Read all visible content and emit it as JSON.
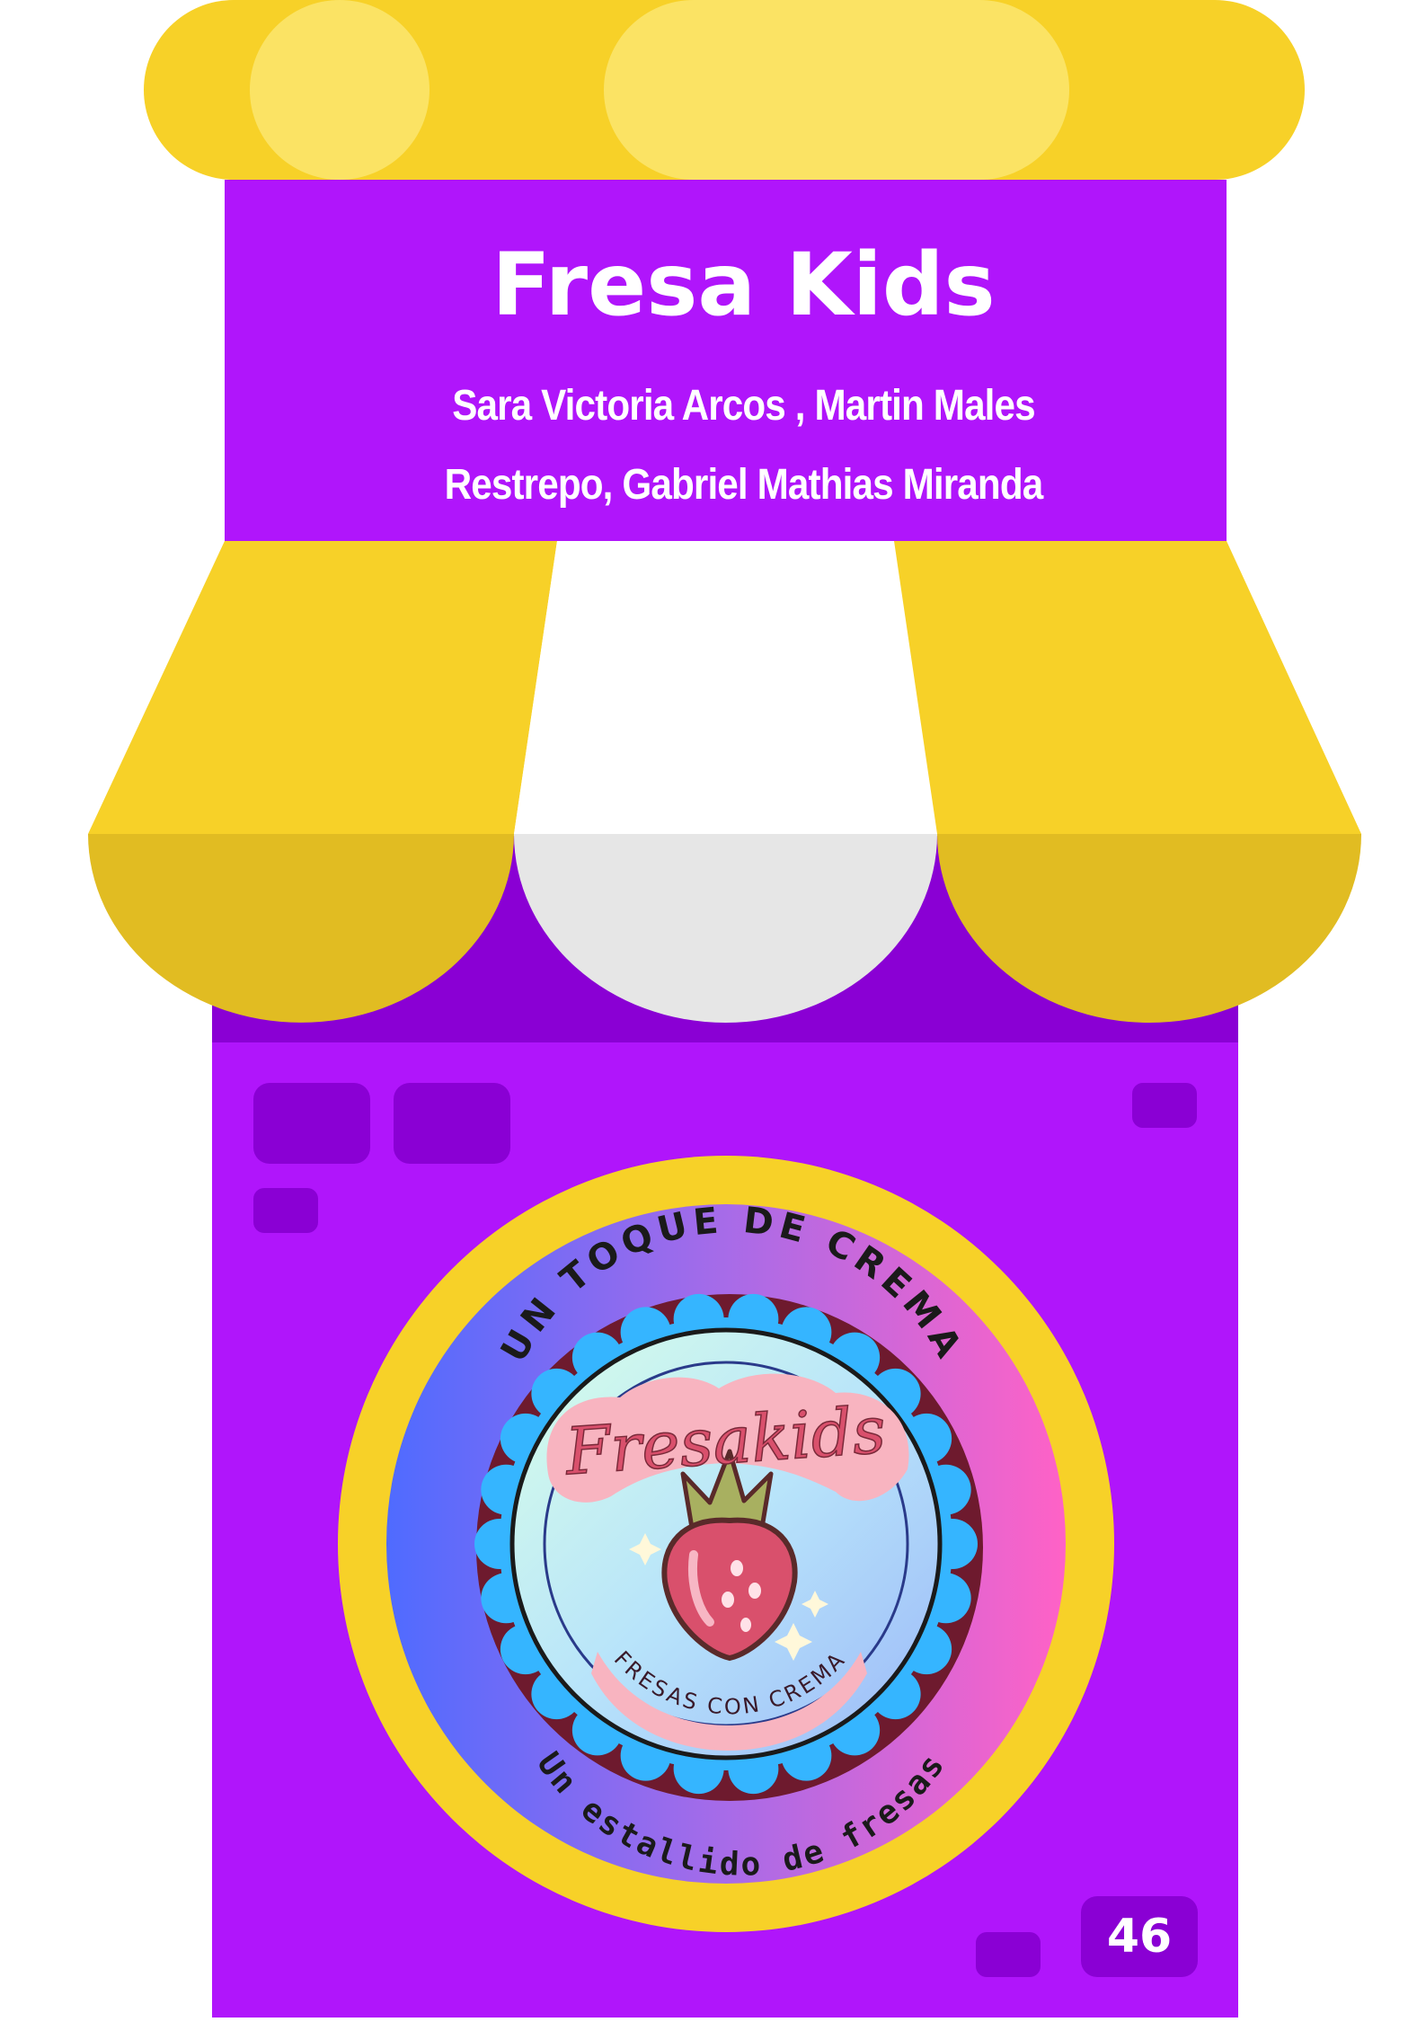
{
  "store": {
    "title": "Fresa Kids",
    "authors_line1": "Sara Victoria Arcos , Martin Males",
    "authors_line2": "Restrepo, Gabriel Mathias Miranda",
    "page_number": "46"
  },
  "logo": {
    "top_arc_text": "UN TOQUE DE CREMA",
    "brand_script": "Fresakids",
    "ribbon_text": "FRESAS CON CREMA",
    "bottom_arc_text": "Un estallido de  fresas",
    "icon": "strawberry-icon"
  },
  "colors": {
    "purple": "#B015FB",
    "purple_dark": "#8A00D4",
    "yellow": "#F7D128",
    "yellow_light": "#FBE364",
    "white_stripe": "#FFFFFF",
    "grey_scallop": "#E6E6E6",
    "pink": "#F8B4C0",
    "strawberry": "#D9506C",
    "leaf": "#A8B060"
  }
}
